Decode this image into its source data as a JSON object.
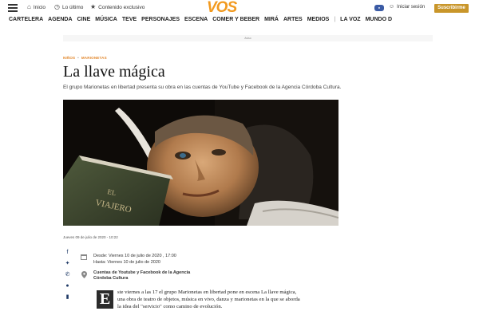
{
  "header": {
    "nav_links": [
      {
        "icon": "home-icon",
        "label": "Inicio"
      },
      {
        "icon": "clock-icon",
        "label": "Lo último"
      },
      {
        "icon": "star-icon",
        "label": "Contenido exclusivo"
      }
    ],
    "logo": "VOS",
    "login_label": "Iniciar sesión",
    "subscribe_label": "Suscribirme",
    "accent_color": "#f29a1f",
    "subscribe_color": "#c9962a"
  },
  "sections": [
    "CARTELERA",
    "AGENDA",
    "CINE",
    "MÚSICA",
    "TEVE",
    "PERSONAJES",
    "ESCENA",
    "COMER Y BEBER",
    "MIRÁ",
    "ARTES",
    "MEDIOS",
    "LA VOZ",
    "MUNDO D"
  ],
  "ad_label": "Aviso",
  "article": {
    "breadcrumbs": [
      "NIÑOS",
      "MARIONETAS"
    ],
    "title": "La llave mágica",
    "lead": "El grupo Marionetas en libertad presenta su obra en las cuentas de YouTube y Facebook de la Agencia Córdoba Cultura.",
    "date": "Jueves 09 de julio de 2020 - 10:22",
    "event": {
      "from": "Desde: Viernes 10 de julio de 2020 , 17:00",
      "to": "Hasta: Viernes 10 de julio de 2020",
      "venue_line1": "Cuentas de Youtube y Facebook de la Agencia",
      "venue_line2": "Córdoba Cultura"
    },
    "drop_cap": "E",
    "body": "ste viernes a las 17 el grupo Marionetas en libertad pone en escena La llave mágica, una obra de teatro de objetos, música en vivo, danza y marionetas en la que se aborda la idea del \"servicio\" como camino de evolución."
  },
  "share_icons": [
    "facebook-icon",
    "twitter-icon",
    "whatsapp-icon",
    "comment-icon",
    "bookmark-icon"
  ]
}
